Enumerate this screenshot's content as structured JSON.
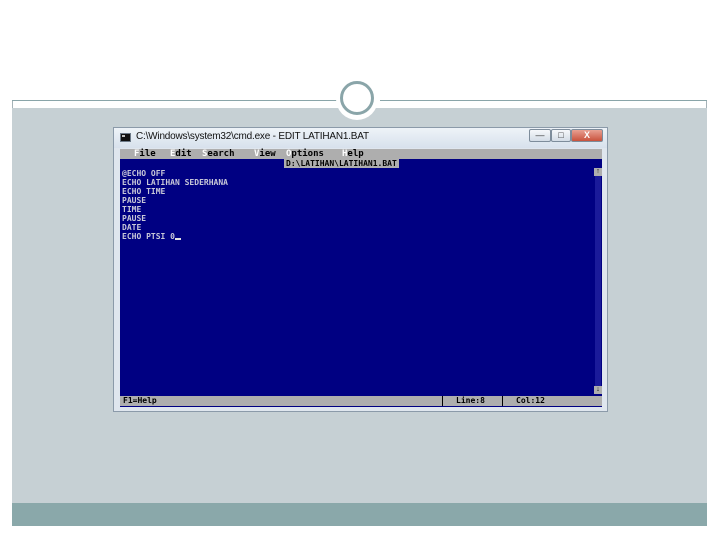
{
  "window": {
    "title": "C:\\Windows\\system32\\cmd.exe - EDIT  LATIHAN1.BAT",
    "minimize_glyph": "—",
    "maximize_glyph": "□",
    "close_glyph": "X"
  },
  "menu": [
    {
      "hot": "F",
      "rest": "ile"
    },
    {
      "hot": "E",
      "rest": "dit"
    },
    {
      "hot": "S",
      "rest": "earch"
    },
    {
      "hot": "V",
      "rest": "iew"
    },
    {
      "hot": "O",
      "rest": "ptions"
    },
    {
      "hot": "H",
      "rest": "elp"
    }
  ],
  "file_path": "D:\\LATIHAN\\LATIHAN1.BAT",
  "code_lines": [
    "@ECHO OFF",
    "ECHO LATIHAN SEDERHANA",
    "ECHO TIME",
    "PAUSE",
    "TIME",
    "PAUSE",
    "DATE",
    "ECHO PTSI 0"
  ],
  "status": {
    "help": "F1=Help",
    "line": "Line:8",
    "col": "Col:12"
  },
  "scroll": {
    "up": "↑",
    "down": "↓"
  },
  "icons": {
    "window": "cmd-icon",
    "minimize": "minimize-icon",
    "maximize": "maximize-icon",
    "close": "close-icon"
  },
  "colors": {
    "editor_bg": "#000082",
    "menu_bg": "#aeaeae",
    "slide_band": "#c6d0d4",
    "slide_footer": "#8aa8aa"
  }
}
